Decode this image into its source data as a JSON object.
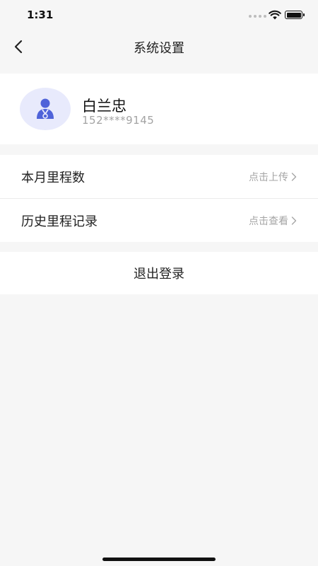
{
  "status_bar": {
    "time": "1:31"
  },
  "nav": {
    "title": "系统设置"
  },
  "profile": {
    "name": "白兰忠",
    "phone": "152****9145"
  },
  "settings": [
    {
      "label": "本月里程数",
      "action": "点击上传"
    },
    {
      "label": "历史里程记录",
      "action": "点击查看"
    }
  ],
  "logout_label": "退出登录",
  "colors": {
    "avatar_bg": "#e8eafc",
    "avatar_icon": "#4f63d9",
    "page_bg": "#f6f6f6"
  }
}
